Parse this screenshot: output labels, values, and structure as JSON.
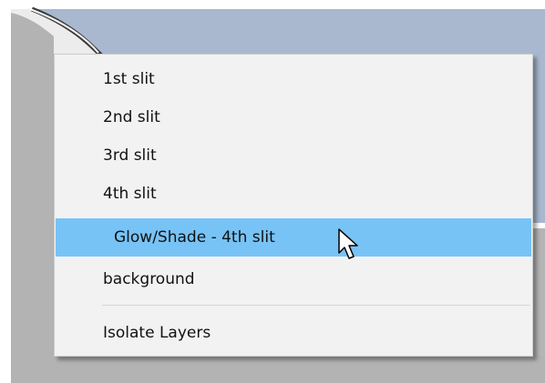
{
  "menu": {
    "items": [
      {
        "label": "1st slit"
      },
      {
        "label": "2nd slit"
      },
      {
        "label": "3rd slit"
      },
      {
        "label": "4th slit"
      },
      {
        "label": "Glow/Shade - 4th slit",
        "highlighted": true
      },
      {
        "label": "background"
      },
      {
        "label": "Isolate Layers"
      }
    ]
  },
  "colors": {
    "highlight": "#77c3f6",
    "menu_background": "#f2f2f2",
    "canvas_blue": "#a9b8cf",
    "canvas_gray": "#b5b5b5"
  }
}
